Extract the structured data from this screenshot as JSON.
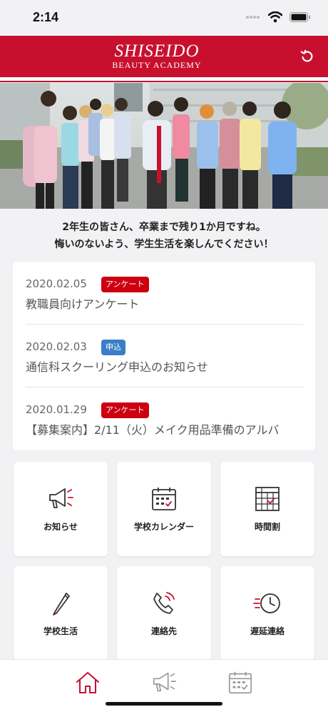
{
  "status_bar": {
    "time": "2:14"
  },
  "header": {
    "brand": "SHISEIDO",
    "subtitle": "BEAUTY ACADEMY",
    "accent": "#c8102e"
  },
  "message": {
    "line1": "2年生の皆さん、卒業まで残り1か月ですね。",
    "line2": "悔いのないよう、学生生活を楽しんでください！"
  },
  "news": [
    {
      "date": "2020.02.05",
      "badge": "アンケート",
      "badge_color": "#cc0010",
      "title": "教職員向けアンケート"
    },
    {
      "date": "2020.02.03",
      "badge": "申込",
      "badge_color": "#3a7ec7",
      "title": "通信科スクーリング申込のお知らせ"
    },
    {
      "date": "2020.01.29",
      "badge": "アンケート",
      "badge_color": "#cc0010",
      "title": "【募集案内】2/11（火）メイク用品準備のアルバ"
    }
  ],
  "menu": [
    {
      "label": "お知らせ",
      "icon": "megaphone-icon"
    },
    {
      "label": "学校カレンダー",
      "icon": "calendar-icon"
    },
    {
      "label": "時間割",
      "icon": "timetable-icon"
    },
    {
      "label": "学校生活",
      "icon": "pencil-icon"
    },
    {
      "label": "連絡先",
      "icon": "phone-icon"
    },
    {
      "label": "遅延連絡",
      "icon": "clock-icon"
    }
  ],
  "tabbar": [
    {
      "icon": "home-icon",
      "active": true
    },
    {
      "icon": "megaphone-icon",
      "active": false
    },
    {
      "icon": "calendar-icon",
      "active": false
    }
  ]
}
